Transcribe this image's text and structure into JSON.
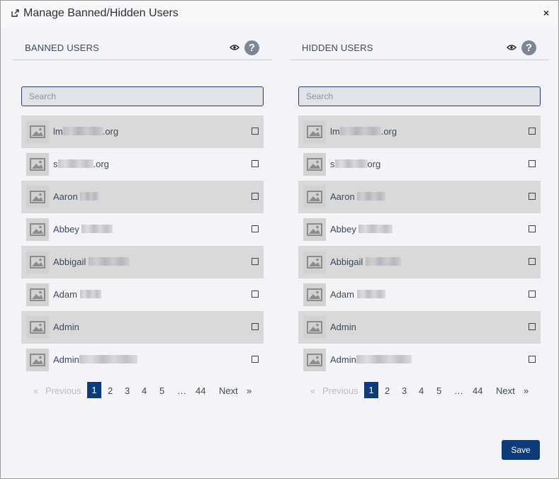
{
  "modal": {
    "title": "Manage Banned/Hidden Users",
    "close_label": "×",
    "save_label": "Save"
  },
  "banned": {
    "title": "BANNED USERS",
    "help_label": "?",
    "search_placeholder": "Search",
    "users": [
      {
        "prefix": "lm",
        "suffix": ".org"
      },
      {
        "prefix": "s",
        "suffix": ".org"
      },
      {
        "prefix": "Aaron ",
        "suffix": ""
      },
      {
        "prefix": "Abbey ",
        "suffix": ""
      },
      {
        "prefix": "Abbigail ",
        "suffix": ""
      },
      {
        "prefix": "Adam ",
        "suffix": ""
      },
      {
        "prefix": "Admin",
        "suffix": ""
      },
      {
        "prefix": "Admin",
        "suffix": ""
      }
    ],
    "pagination": {
      "first": "«",
      "previous": "Previous",
      "pages": [
        "1",
        "2",
        "3",
        "4",
        "5"
      ],
      "ellipsis": "…",
      "last_page": "44",
      "next": "Next",
      "last": "»",
      "active_page": "1"
    }
  },
  "hidden": {
    "title": "HIDDEN USERS",
    "help_label": "?",
    "search_placeholder": "Search",
    "users": [
      {
        "prefix": "lm",
        "suffix": ".org"
      },
      {
        "prefix": "s",
        "suffix": "org"
      },
      {
        "prefix": "Aaron ",
        "suffix": ""
      },
      {
        "prefix": "Abbey ",
        "suffix": ""
      },
      {
        "prefix": "Abbigail ",
        "suffix": ""
      },
      {
        "prefix": "Adam ",
        "suffix": ""
      },
      {
        "prefix": "Admin",
        "suffix": ""
      },
      {
        "prefix": "Admin",
        "suffix": ""
      }
    ],
    "pagination": {
      "first": "«",
      "previous": "Previous",
      "pages": [
        "1",
        "2",
        "3",
        "4",
        "5"
      ],
      "ellipsis": "…",
      "last_page": "44",
      "next": "Next",
      "last": "»",
      "active_page": "1"
    }
  },
  "icons": {
    "title": "external-link-icon",
    "visibility": "eye-icon",
    "help": "question-circle-icon",
    "avatar": "image-placeholder-icon",
    "checkbox": "checkbox-icon"
  },
  "colors": {
    "accent": "#0e3b7a",
    "row_shaded": "#d9d9d9",
    "background": "#f4f4f8",
    "help_icon": "#7b8796"
  }
}
